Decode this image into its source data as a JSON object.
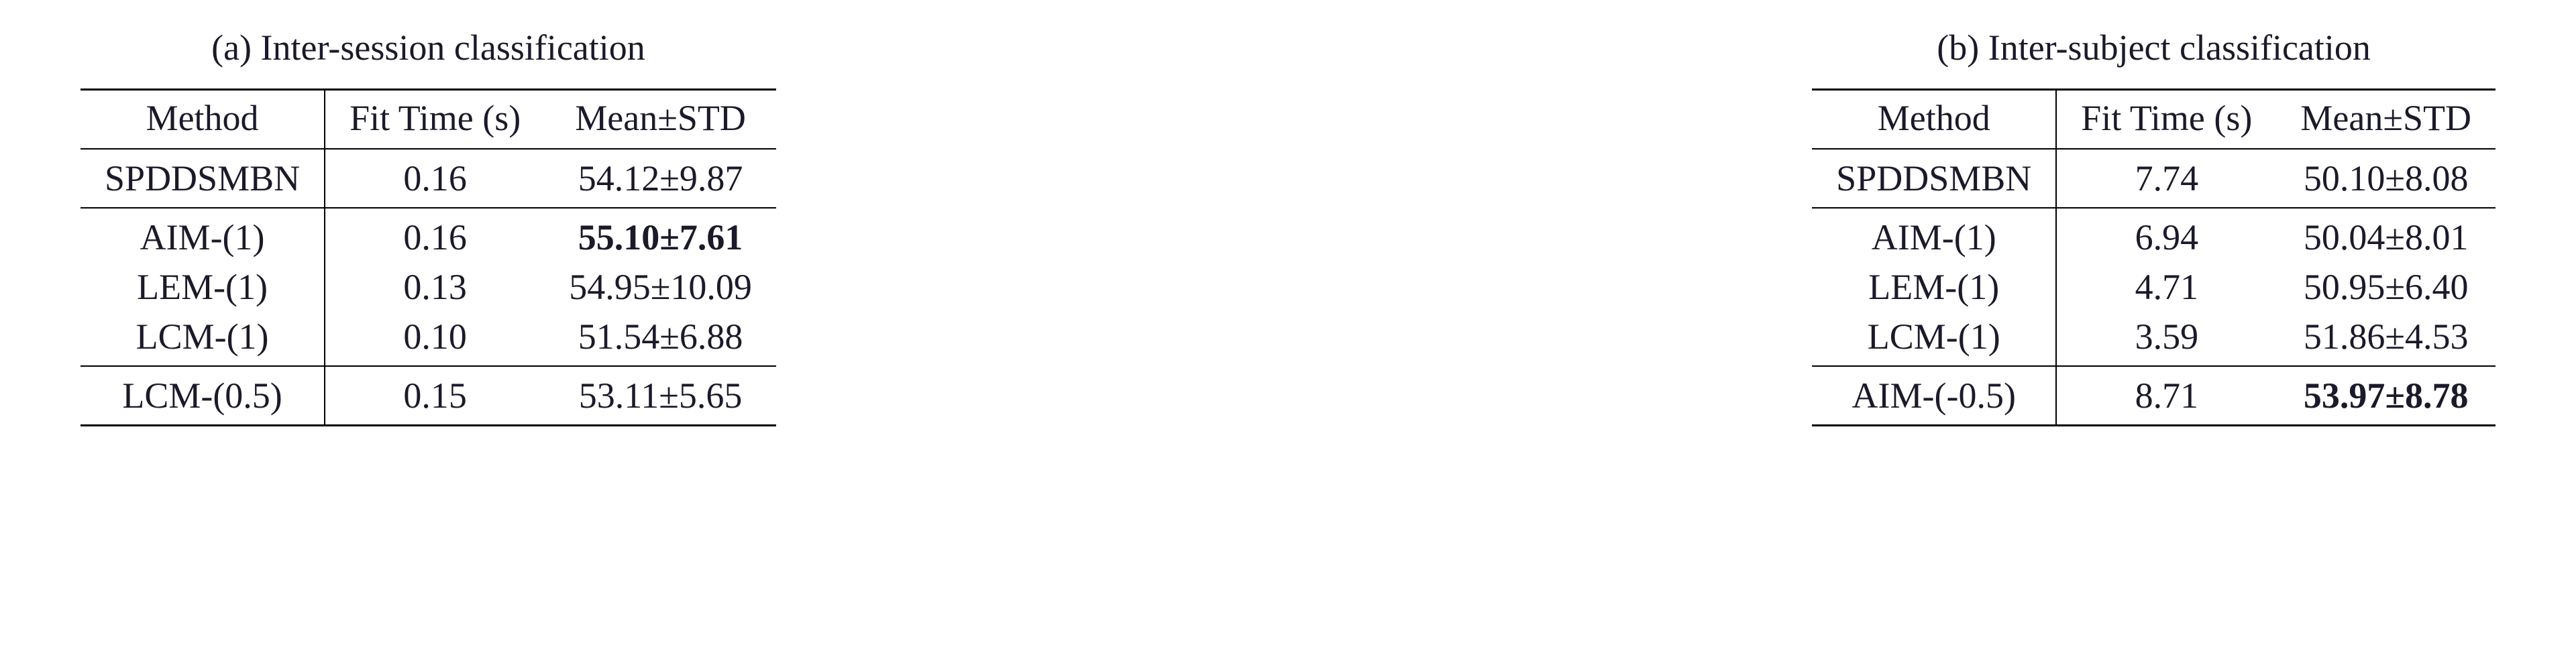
{
  "tables": [
    {
      "caption": "(a) Inter-session classification",
      "headers": {
        "method": "Method",
        "fit": "Fit Time (s)",
        "mean": "Mean±STD"
      },
      "rows": [
        {
          "method": "SPDDSMBN",
          "fit": "0.16",
          "mean": "54.12±9.87",
          "bold": false
        },
        {
          "method": "AIM-(1)",
          "fit": "0.16",
          "mean": "55.10±7.61",
          "bold": true
        },
        {
          "method": "LEM-(1)",
          "fit": "0.13",
          "mean": "54.95±10.09",
          "bold": false
        },
        {
          "method": "LCM-(1)",
          "fit": "0.10",
          "mean": "51.54±6.88",
          "bold": false
        },
        {
          "method": "LCM-(0.5)",
          "fit": "0.15",
          "mean": "53.11±5.65",
          "bold": false
        }
      ]
    },
    {
      "caption": "(b) Inter-subject classification",
      "headers": {
        "method": "Method",
        "fit": "Fit Time (s)",
        "mean": "Mean±STD"
      },
      "rows": [
        {
          "method": "SPDDSMBN",
          "fit": "7.74",
          "mean": "50.10±8.08",
          "bold": false
        },
        {
          "method": "AIM-(1)",
          "fit": "6.94",
          "mean": "50.04±8.01",
          "bold": false
        },
        {
          "method": "LEM-(1)",
          "fit": "4.71",
          "mean": "50.95±6.40",
          "bold": false
        },
        {
          "method": "LCM-(1)",
          "fit": "3.59",
          "mean": "51.86±4.53",
          "bold": false
        },
        {
          "method": "AIM-(-0.5)",
          "fit": "8.71",
          "mean": "53.97±8.78",
          "bold": true
        }
      ]
    }
  ]
}
